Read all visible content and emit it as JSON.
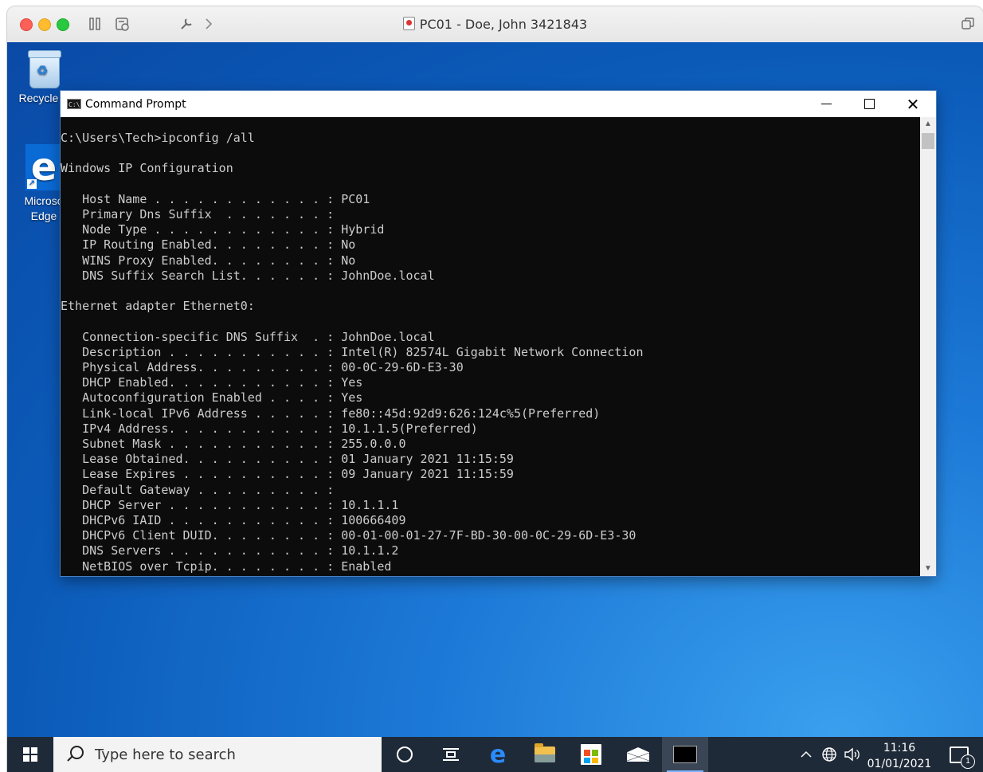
{
  "host_window": {
    "title": "PC01 - Doe, John 3421843"
  },
  "desktop": {
    "icons": [
      {
        "label": "Recycle B"
      },
      {
        "label": "Microso Edge"
      }
    ]
  },
  "cmd_window": {
    "title": "Command Prompt",
    "lines": [
      "C:\\Users\\Tech>ipconfig /all",
      "",
      "Windows IP Configuration",
      "",
      "   Host Name . . . . . . . . . . . . : PC01",
      "   Primary Dns Suffix  . . . . . . . : ",
      "   Node Type . . . . . . . . . . . . : Hybrid",
      "   IP Routing Enabled. . . . . . . . : No",
      "   WINS Proxy Enabled. . . . . . . . : No",
      "   DNS Suffix Search List. . . . . . : JohnDoe.local",
      "",
      "Ethernet adapter Ethernet0:",
      "",
      "   Connection-specific DNS Suffix  . : JohnDoe.local",
      "   Description . . . . . . . . . . . : Intel(R) 82574L Gigabit Network Connection",
      "   Physical Address. . . . . . . . . : 00-0C-29-6D-E3-30",
      "   DHCP Enabled. . . . . . . . . . . : Yes",
      "   Autoconfiguration Enabled . . . . : Yes",
      "   Link-local IPv6 Address . . . . . : fe80::45d:92d9:626:124c%5(Preferred)",
      "   IPv4 Address. . . . . . . . . . . : 10.1.1.5(Preferred)",
      "   Subnet Mask . . . . . . . . . . . : 255.0.0.0",
      "   Lease Obtained. . . . . . . . . . : 01 January 2021 11:15:59",
      "   Lease Expires . . . . . . . . . . : 09 January 2021 11:15:59",
      "   Default Gateway . . . . . . . . . : ",
      "   DHCP Server . . . . . . . . . . . : 10.1.1.1",
      "   DHCPv6 IAID . . . . . . . . . . . : 100666409",
      "   DHCPv6 Client DUID. . . . . . . . : 00-01-00-01-27-7F-BD-30-00-0C-29-6D-E3-30",
      "   DNS Servers . . . . . . . . . . . : 10.1.1.2",
      "   NetBIOS over Tcpip. . . . . . . . : Enabled"
    ]
  },
  "taskbar": {
    "search_placeholder": "Type here to search",
    "clock_time": "11:16",
    "clock_date": "01/01/2021",
    "notification_count": "1"
  },
  "icons": {
    "search": "search-icon",
    "cortana": "cortana-icon",
    "task_view": "task-view-icon",
    "edge": "edge-icon",
    "explorer": "file-explorer-icon",
    "store": "store-icon",
    "mail": "mail-icon",
    "cmd": "command-prompt-icon"
  },
  "colors": {
    "desktop_blue": "#0b5ab8",
    "taskbar": "#1f2a38",
    "console_bg": "#0c0c0c",
    "console_text": "#cccccc"
  }
}
